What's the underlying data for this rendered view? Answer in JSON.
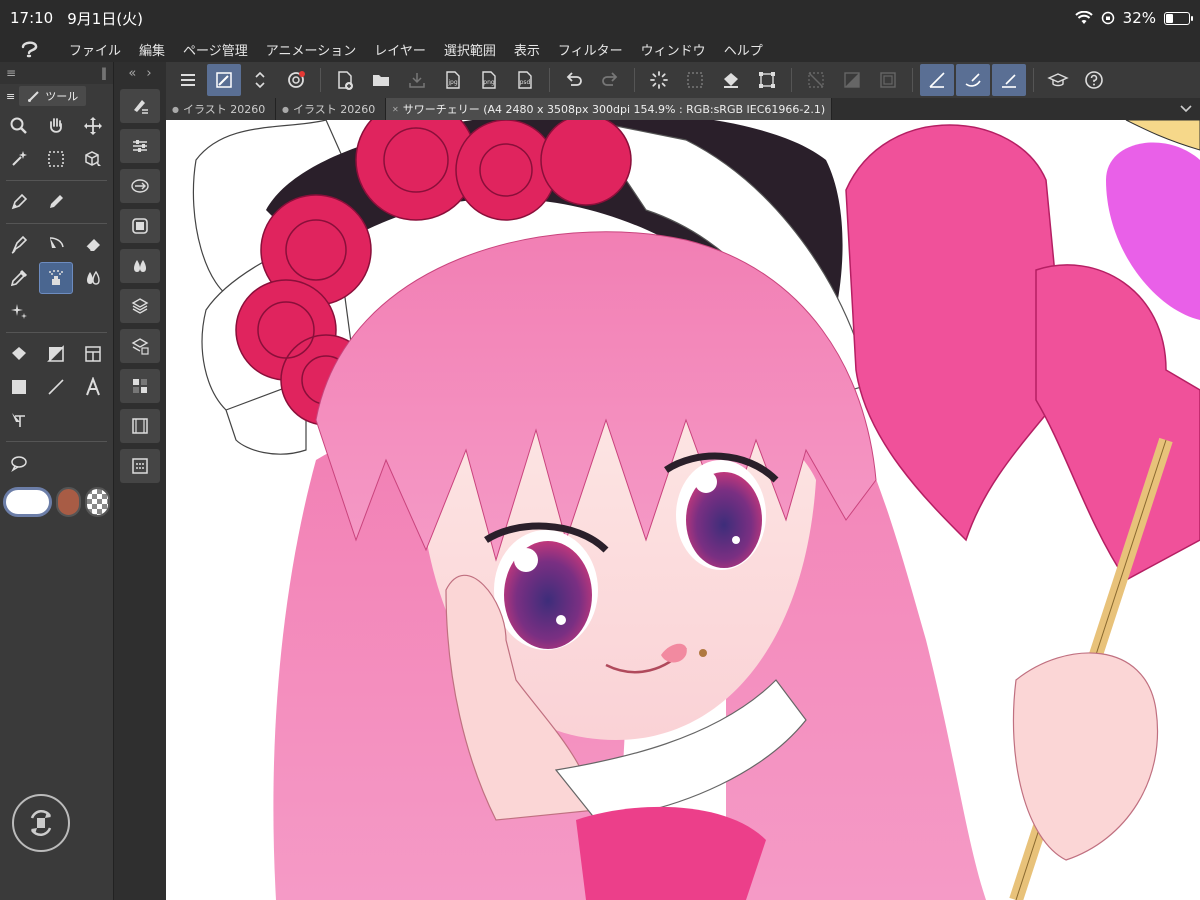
{
  "status": {
    "time": "17:10",
    "date": "9月1日(火)",
    "battery": "32%",
    "battery_level": 0.32
  },
  "menu": [
    "ファイル",
    "編集",
    "ページ管理",
    "アニメーション",
    "レイヤー",
    "選択範囲",
    "表示",
    "フィルター",
    "ウィンドウ",
    "ヘルプ"
  ],
  "toolpanel": {
    "tab_label": "ツール"
  },
  "tabs": [
    {
      "label": "イラスト 20260"
    },
    {
      "label": "イラスト 20260"
    },
    {
      "label": "サワーチェリー (A4 2480 x 3508px 300dpi 154.9% : RGB:sRGB IEC61966-2.1)"
    }
  ],
  "colors": {
    "main": "#ffffff",
    "sub": "#a85c45",
    "accent": "#5a6f94"
  }
}
